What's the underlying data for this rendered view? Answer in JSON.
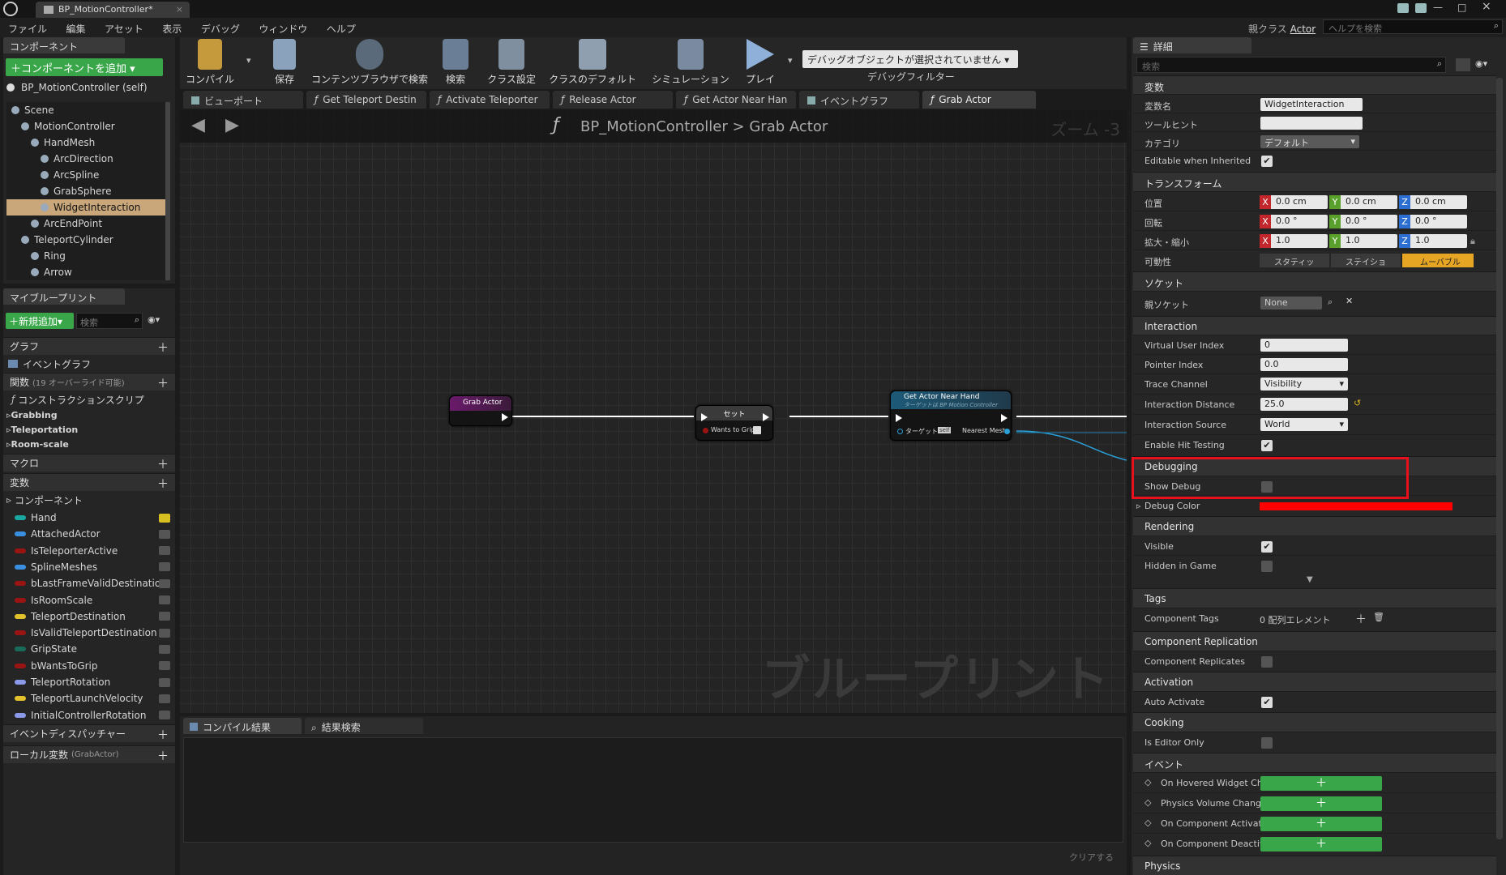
{
  "app": {
    "tab_title": "BP_MotionController*",
    "parent_class_label": "親クラス",
    "parent_class_value": "Actor",
    "help_search_placeholder": "ヘルプを検索"
  },
  "menu": [
    "ファイル",
    "編集",
    "アセット",
    "表示",
    "デバッグ",
    "ウィンドウ",
    "ヘルプ"
  ],
  "components_panel": {
    "tab": "コンポーネント",
    "add_button": "コンポーネントを追加",
    "self_item": "BP_MotionController (self)",
    "tree": [
      {
        "label": "Scene",
        "indent": 0
      },
      {
        "label": "MotionController",
        "indent": 1
      },
      {
        "label": "HandMesh",
        "indent": 2
      },
      {
        "label": "ArcDirection",
        "indent": 3
      },
      {
        "label": "ArcSpline",
        "indent": 3
      },
      {
        "label": "GrabSphere",
        "indent": 3
      },
      {
        "label": "WidgetInteraction",
        "indent": 3,
        "selected": true
      },
      {
        "label": "ArcEndPoint",
        "indent": 2
      },
      {
        "label": "TeleportCylinder",
        "indent": 1
      },
      {
        "label": "Ring",
        "indent": 2
      },
      {
        "label": "Arrow",
        "indent": 2
      }
    ]
  },
  "myblueprint": {
    "tab": "マイブループリント",
    "new_button": "新規追加",
    "search_placeholder": "検索",
    "graph_section": "グラフ",
    "event_graph": "イベントグラフ",
    "functions_section": "関数",
    "functions_note": "(19 オーバーライド可能)",
    "construction_script": "コンストラクションスクリプ",
    "categories": [
      "Grabbing",
      "Teleportation",
      "Room-scale"
    ],
    "macros_section": "マクロ",
    "variables_section": "変数",
    "components_category": "コンポーネント",
    "variables": [
      {
        "name": "Hand",
        "color": "#1aa7a0"
      },
      {
        "name": "AttachedActor",
        "color": "#3b8fe0"
      },
      {
        "name": "IsTeleporterActive",
        "color": "#9b1414"
      },
      {
        "name": "SplineMeshes",
        "color": "#3b8fe0"
      },
      {
        "name": "bLastFrameValidDestinatio",
        "color": "#9b1414"
      },
      {
        "name": "IsRoomScale",
        "color": "#9b1414"
      },
      {
        "name": "TeleportDestination",
        "color": "#e2c12d"
      },
      {
        "name": "IsValidTeleportDestination",
        "color": "#9b1414"
      },
      {
        "name": "GripState",
        "color": "#1a6a5a"
      },
      {
        "name": "bWantsToGrip",
        "color": "#9b1414"
      },
      {
        "name": "TeleportRotation",
        "color": "#8a9ae8"
      },
      {
        "name": "TeleportLaunchVelocity",
        "color": "#e2c12d"
      },
      {
        "name": "InitialControllerRotation",
        "color": "#8a9ae8"
      }
    ],
    "dispatchers_section": "イベントディスパッチャー",
    "local_vars_section": "ローカル変数",
    "local_vars_note": "(GrabActor)"
  },
  "toolbar": {
    "compile": "コンパイル",
    "save": "保存",
    "browse": "コンテンツブラウザで検索",
    "find": "検索",
    "class_settings": "クラス設定",
    "class_defaults": "クラスのデフォルト",
    "simulation": "シミュレーション",
    "play": "プレイ",
    "debug_object": "デバッグオブジェクトが選択されていません",
    "debug_filter": "デバッグフィルター"
  },
  "graph_tabs": [
    "ビューポート",
    "Get Teleport Destin",
    "Activate Teleporter",
    "Release Actor",
    "Get Actor Near Han",
    "イベントグラフ",
    "Grab Actor"
  ],
  "graph": {
    "breadcrumb_root": "BP_MotionController",
    "breadcrumb_sep": ">",
    "breadcrumb_current": "Grab Actor",
    "zoom": "ズーム -3",
    "watermark": "ブループリント",
    "node_grab": "Grab Actor",
    "node_set": "セット",
    "node_set_pin": "Wants to Grip",
    "node_near": "Get Actor Near Hand",
    "node_near_sub": "ターゲットは BP Motion Controller",
    "node_near_target": "ターゲット",
    "node_near_self": "self",
    "node_near_out": "Nearest Mesh"
  },
  "bottom": {
    "tab_compile": "コンパイル結果",
    "tab_search": "結果検索",
    "clear": "クリアする"
  },
  "details": {
    "tab": "詳細",
    "search_placeholder": "検索",
    "sec_variable": "変数",
    "var_name_label": "変数名",
    "var_name_value": "WidgetInteraction",
    "tooltip_label": "ツールヒント",
    "tooltip_value": "",
    "category_label": "カテゴリ",
    "category_value": "デフォルト",
    "editable_label": "Editable when Inherited",
    "sec_transform": "トランスフォーム",
    "location_label": "位置",
    "rotation_label": "回転",
    "scale_label": "拡大・縮小",
    "location": [
      "0.0 cm",
      "0.0 cm",
      "0.0 cm"
    ],
    "rotation": [
      "0.0 °",
      "0.0 °",
      "0.0 °"
    ],
    "scale": [
      "1.0",
      "1.0",
      "1.0"
    ],
    "mobility_label": "可動性",
    "mobility": [
      "スタティッ",
      "ステイショ",
      "ムーバブル"
    ],
    "sec_socket": "ソケット",
    "parent_socket_label": "親ソケット",
    "parent_socket_value": "None",
    "sec_interaction": "Interaction",
    "virtual_user_label": "Virtual User Index",
    "virtual_user_value": "0",
    "pointer_index_label": "Pointer Index",
    "pointer_index_value": "0.0",
    "trace_channel_label": "Trace Channel",
    "trace_channel_value": "Visibility",
    "interaction_distance_label": "Interaction Distance",
    "interaction_distance_value": "25.0",
    "interaction_source_label": "Interaction Source",
    "interaction_source_value": "World",
    "enable_hit_label": "Enable Hit Testing",
    "sec_debugging": "Debugging",
    "show_debug_label": "Show Debug",
    "debug_color_label": "Debug Color",
    "debug_color": "#ff0000",
    "sec_rendering": "Rendering",
    "visible_label": "Visible",
    "hidden_label": "Hidden in Game",
    "sec_tags": "Tags",
    "component_tags_label": "Component Tags",
    "component_tags_value": "0 配列エレメント",
    "sec_replication": "Component Replication",
    "replicates_label": "Component Replicates",
    "sec_activation": "Activation",
    "auto_activate_label": "Auto Activate",
    "sec_cooking": "Cooking",
    "editor_only_label": "Is Editor Only",
    "sec_events": "イベント",
    "events": [
      "On Hovered Widget Cha",
      "Physics Volume Chang",
      "On Component Activate",
      "On Component Deactiv"
    ],
    "sec_physics": "Physics"
  },
  "colors": {
    "highlight_red": "#e8101c",
    "selected_item": "#c9a77a",
    "add_green": "#3aa64a",
    "exec_wire": "#ffffff",
    "object_wire": "#2aa0d8"
  }
}
